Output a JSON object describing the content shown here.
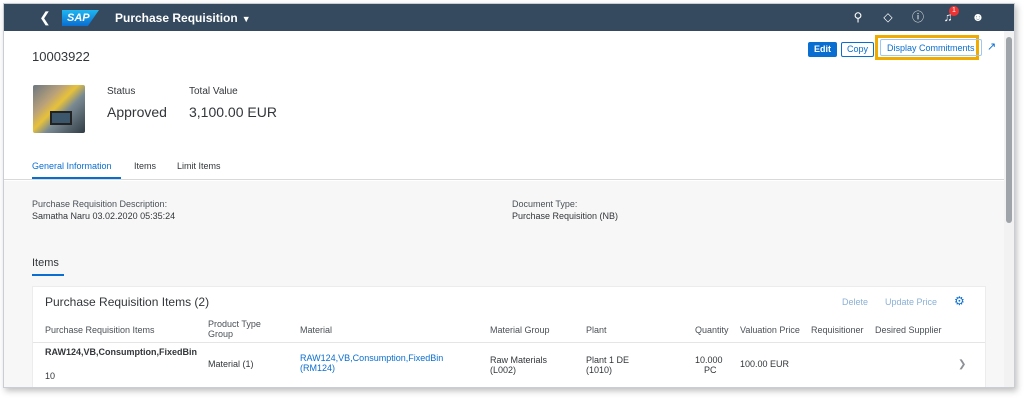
{
  "shell": {
    "back_icon": "chevron-left",
    "logo_text": "SAP",
    "app_title": "Purchase Requisition",
    "notification_count": "1"
  },
  "header": {
    "object_id": "10003922",
    "actions": {
      "edit": "Edit",
      "copy": "Copy",
      "display_commitments": "Display Commitments"
    },
    "status_label": "Status",
    "status_value": "Approved",
    "total_label": "Total Value",
    "total_value": "3,100.00  EUR"
  },
  "tabs": [
    "General Information",
    "Items",
    "Limit Items"
  ],
  "general": {
    "desc_label": "Purchase Requisition Description:",
    "desc_value": "Samatha Naru 03.02.2020 05:35:24",
    "doctype_label": "Document Type:",
    "doctype_value": "Purchase Requisition (NB)"
  },
  "items_section": {
    "heading": "Items",
    "table_title": "Purchase Requisition Items (2)",
    "delete": "Delete",
    "update_price": "Update Price",
    "columns": [
      "Purchase Requisition Items",
      "Product Type Group",
      "Material",
      "Material Group",
      "Plant",
      "Quantity",
      "Valuation Price",
      "Requisitioner",
      "Desired Supplier"
    ],
    "row": {
      "item_name": "RAW124,VB,Consumption,FixedBin",
      "item_no": "10",
      "product_type": "Material (1)",
      "material": "RAW124,VB,Consumption,FixedBin (RM124)",
      "material_group": "Raw Materials (L002)",
      "plant": "Plant 1 DE (1010)",
      "quantity": "10.000",
      "uom": "PC",
      "price": "100.00  EUR"
    }
  },
  "colors": {
    "shell": "#354a5f",
    "accent": "#0a6ed1",
    "highlight": "#f0ab00"
  }
}
